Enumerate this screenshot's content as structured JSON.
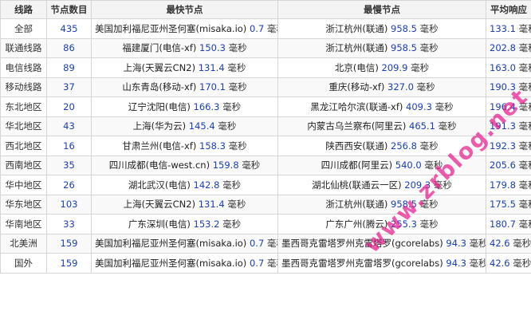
{
  "headers": [
    "线路",
    "节点数目",
    "最快节点",
    "最慢节点",
    "平均响应"
  ],
  "unit": "毫秒",
  "rows": [
    {
      "line": "全部",
      "count": "435",
      "fast_node": "美国加利福尼亚州圣何塞(misaka.io)",
      "fast_ms": "0.7",
      "slow_node": "浙江杭州(联通)",
      "slow_ms": "958.5",
      "avg_ms": "133.1"
    },
    {
      "line": "联通线路",
      "count": "86",
      "fast_node": "福建厦门(电信-xf)",
      "fast_ms": "150.3",
      "slow_node": "浙江杭州(联通)",
      "slow_ms": "958.5",
      "avg_ms": "202.8"
    },
    {
      "line": "电信线路",
      "count": "89",
      "fast_node": "上海(天翼云CN2)",
      "fast_ms": "131.4",
      "slow_node": "北京(电信)",
      "slow_ms": "209.9",
      "avg_ms": "163.0"
    },
    {
      "line": "移动线路",
      "count": "37",
      "fast_node": "山东青岛(移动-xf)",
      "fast_ms": "170.1",
      "slow_node": "重庆(移动-xf)",
      "slow_ms": "327.0",
      "avg_ms": "190.3"
    },
    {
      "line": "东北地区",
      "count": "20",
      "fast_node": "辽宁沈阳(电信)",
      "fast_ms": "166.3",
      "slow_node": "黑龙江哈尔滨(联通-xf)",
      "slow_ms": "409.3",
      "avg_ms": "196.4"
    },
    {
      "line": "华北地区",
      "count": "43",
      "fast_node": "上海(华为云)",
      "fast_ms": "145.4",
      "slow_node": "内蒙古乌兰察布(阿里云)",
      "slow_ms": "465.1",
      "avg_ms": "191.3"
    },
    {
      "line": "西北地区",
      "count": "16",
      "fast_node": "甘肃兰州(电信-xf)",
      "fast_ms": "158.3",
      "slow_node": "陕西西安(联通)",
      "slow_ms": "256.8",
      "avg_ms": "192.3"
    },
    {
      "line": "西南地区",
      "count": "35",
      "fast_node": "四川成都(电信-west.cn)",
      "fast_ms": "159.8",
      "slow_node": "四川成都(阿里云)",
      "slow_ms": "540.0",
      "avg_ms": "205.6"
    },
    {
      "line": "华中地区",
      "count": "26",
      "fast_node": "湖北武汉(电信)",
      "fast_ms": "142.8",
      "slow_node": "湖北仙桃(联通云一区)",
      "slow_ms": "209.3",
      "avg_ms": "179.8"
    },
    {
      "line": "华东地区",
      "count": "103",
      "fast_node": "上海(天翼云CN2)",
      "fast_ms": "131.4",
      "slow_node": "浙江杭州(联通)",
      "slow_ms": "958.5",
      "avg_ms": "175.5"
    },
    {
      "line": "华南地区",
      "count": "33",
      "fast_node": "广东深圳(电信)",
      "fast_ms": "153.2",
      "slow_node": "广东广州(腾云)",
      "slow_ms": "255.3",
      "avg_ms": "180.7"
    },
    {
      "line": "北美洲",
      "count": "159",
      "fast_node": "美国加利福尼亚州圣何塞(misaka.io)",
      "fast_ms": "0.7",
      "slow_node": "墨西哥克雷塔罗州克雷塔罗(gcorelabs)",
      "slow_ms": "94.3",
      "avg_ms": "42.6"
    },
    {
      "line": "国外",
      "count": "159",
      "fast_node": "美国加利福尼亚州圣何塞(misaka.io)",
      "fast_ms": "0.7",
      "slow_node": "墨西哥克雷塔罗州克雷塔罗(gcorelabs)",
      "slow_ms": "94.3",
      "avg_ms": "42.6"
    }
  ],
  "watermark": "www.zrblog.net",
  "colors": {
    "value_blue": "#1a3fb8",
    "watermark_pink": "#e8168a"
  }
}
